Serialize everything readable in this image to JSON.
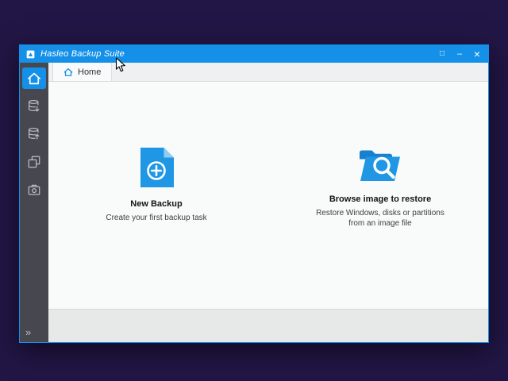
{
  "window": {
    "title": "Hasleo Backup Suite",
    "controls": {
      "maximize": "□",
      "minimize": "–",
      "close": "×"
    }
  },
  "tab_bar": {
    "home_label": "Home"
  },
  "sidebar": {
    "expand_glyph": "»",
    "items": [
      {
        "icon": "home-icon",
        "selected": true
      },
      {
        "icon": "backup-disks-icon",
        "selected": false
      },
      {
        "icon": "restore-disks-icon",
        "selected": false
      },
      {
        "icon": "clone-icon",
        "selected": false
      },
      {
        "icon": "toolkit-icon",
        "selected": false
      }
    ]
  },
  "content": {
    "new_backup": {
      "title": "New Backup",
      "subtitle": "Create your first backup task"
    },
    "browse_restore": {
      "title": "Browse image to restore",
      "subtitle_line1": "Restore Windows, disks or partitions",
      "subtitle_line2": "from an image file"
    }
  },
  "colors": {
    "accent": "#1590e8",
    "sidebar": "#46474f",
    "desktop": "#221646",
    "icon_blue": "#1f97e5"
  }
}
